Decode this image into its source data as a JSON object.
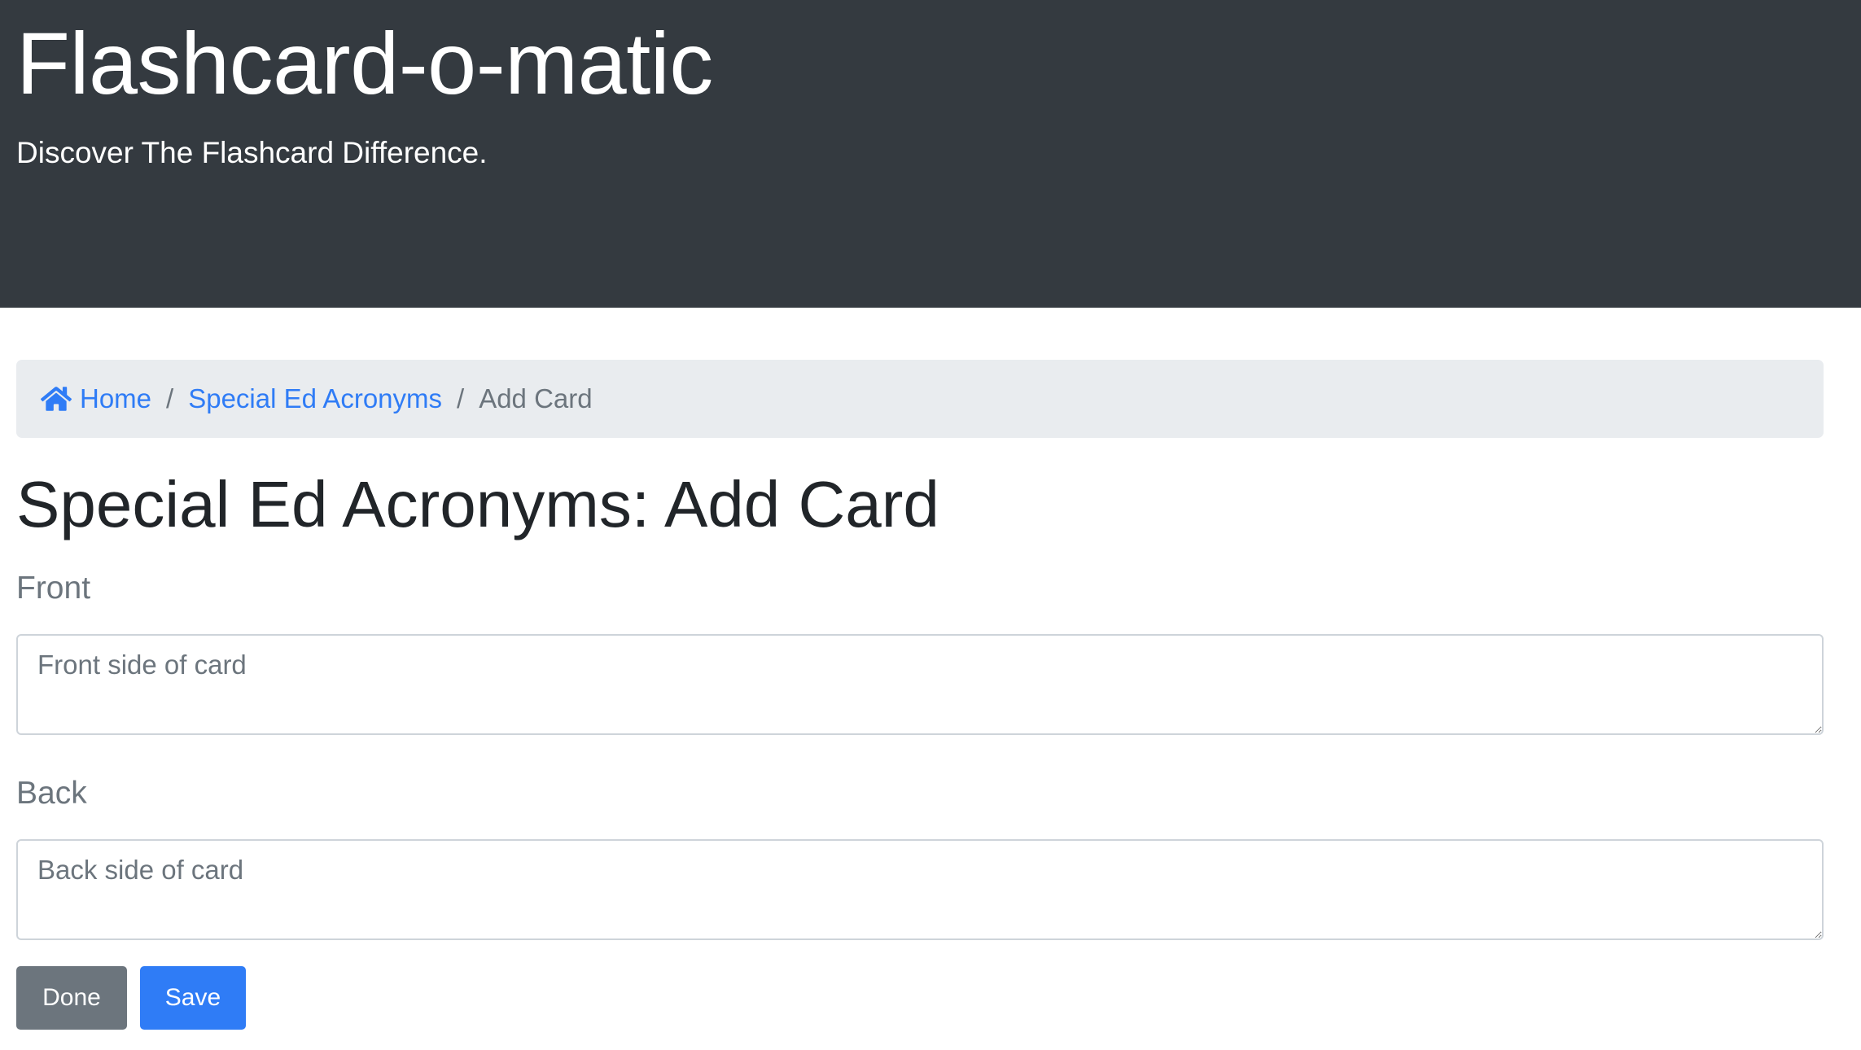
{
  "header": {
    "title": "Flashcard-o-matic",
    "subtitle": "Discover The Flashcard Difference."
  },
  "breadcrumb": {
    "home_icon": "home-icon",
    "home_label": "Home",
    "deck_label": "Special Ed Acronyms",
    "separator": "/",
    "current_label": "Add Card"
  },
  "page": {
    "title": "Special Ed Acronyms: Add Card"
  },
  "form": {
    "front_label": "Front",
    "front_placeholder": "Front side of card",
    "front_value": "",
    "back_label": "Back",
    "back_placeholder": "Back side of card",
    "back_value": ""
  },
  "buttons": {
    "done_label": "Done",
    "save_label": "Save"
  },
  "colors": {
    "header_bg": "#343a40",
    "breadcrumb_bg": "#e9ecef",
    "link": "#2f7cf6",
    "secondary": "#6c757d",
    "primary": "#2f7cf6"
  }
}
